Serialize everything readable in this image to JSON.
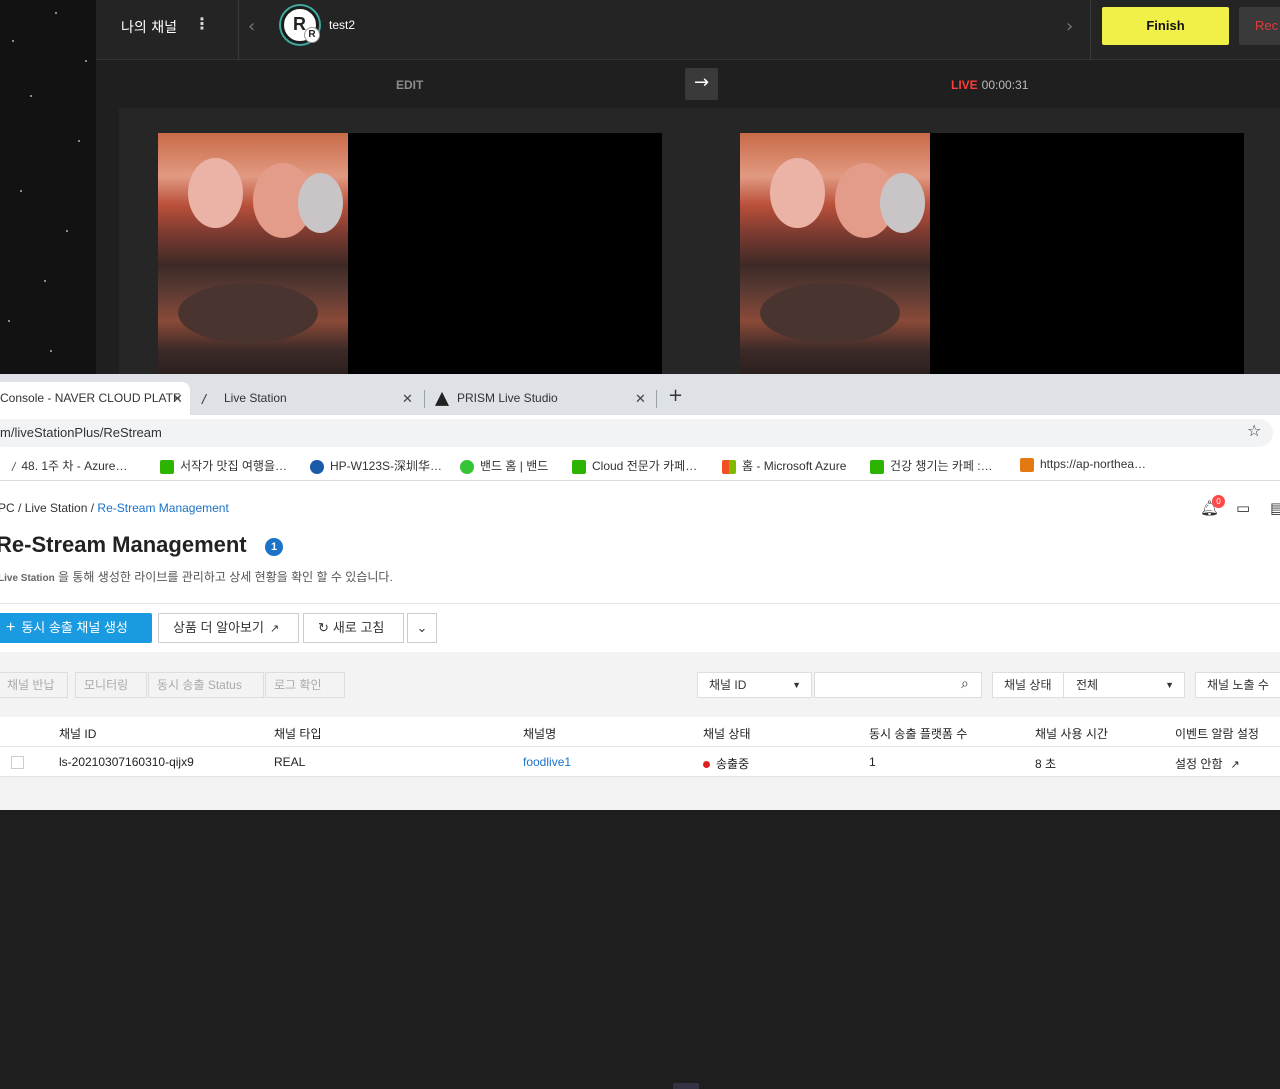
{
  "prism": {
    "channel_title": "나의 채널",
    "avatar_letter": "R",
    "avatar_badge": "R",
    "channel_name": "test2",
    "finish_label": "Finish",
    "rec_label": "Rec",
    "edit_label": "EDIT",
    "live_label": "LIVE",
    "live_time": "00:00:31"
  },
  "browser": {
    "tabs": [
      {
        "label": "Console - NAVER CLOUD PLATF",
        "icon": "naver-cloud-icon"
      },
      {
        "label": "Live Station",
        "icon": "live-station-icon"
      },
      {
        "label": "PRISM Live Studio",
        "icon": "prism-icon"
      }
    ],
    "close_glyph": "✕",
    "new_tab_glyph": "+",
    "url": "m/liveStationPlus/ReStream",
    "bookmarks": [
      {
        "label": "48. 1주 차 - Azure…",
        "color": "#555555"
      },
      {
        "label": "서작가 맛집 여행을…",
        "color": "#2db400"
      },
      {
        "label": "HP-W123S-深圳华…",
        "color": "#1a5aa8"
      },
      {
        "label": "밴드 홈 | 밴드",
        "color": "#35c435"
      },
      {
        "label": "Cloud 전문가 카페…",
        "color": "#2db400"
      },
      {
        "label": "홈 - Microsoft Azure",
        "color": "#f25022"
      },
      {
        "label": "건강 챙기는 카페 :…",
        "color": "#2db400"
      },
      {
        "label": "https://ap-northea…",
        "color": "#e47911"
      }
    ]
  },
  "page": {
    "breadcrumb": [
      "PC",
      "Live Station",
      "Re-Stream Management"
    ],
    "bell_count": "0",
    "title": "Re-Stream Management",
    "info_badge": "1",
    "desc_bold": "Live Station",
    "desc_rest": " 을 통해 생성한 라이브를 관리하고 상세 현황을 확인 할 수 있습니다.",
    "create_button": "동시 송출 채널 생성",
    "more_button": "상품 더 알아보기",
    "refresh_button": "새로 고침",
    "action_buttons": [
      "채널 반납",
      "모니터링",
      "동시 송출 Status",
      "로그 확인"
    ],
    "search_field_select": "채널 ID",
    "search_value": "",
    "status_label": "채널 상태",
    "status_value": "전체",
    "exposure_label": "채널 노출 수",
    "table": {
      "headers": [
        "채널 ID",
        "채널 타입",
        "채널명",
        "채널 상태",
        "동시 송출 플랫폼 수",
        "채널 사용 시간",
        "이벤트 알람 설정"
      ],
      "rows": [
        {
          "id": "ls-20210307160310-qijx9",
          "type": "REAL",
          "name": "foodlive1",
          "status": "송출중",
          "platforms": "1",
          "usage": "8 초",
          "alarm": "설정 안함"
        }
      ]
    },
    "status_color": "#e02020",
    "accent_color": "#1a9ae0"
  }
}
